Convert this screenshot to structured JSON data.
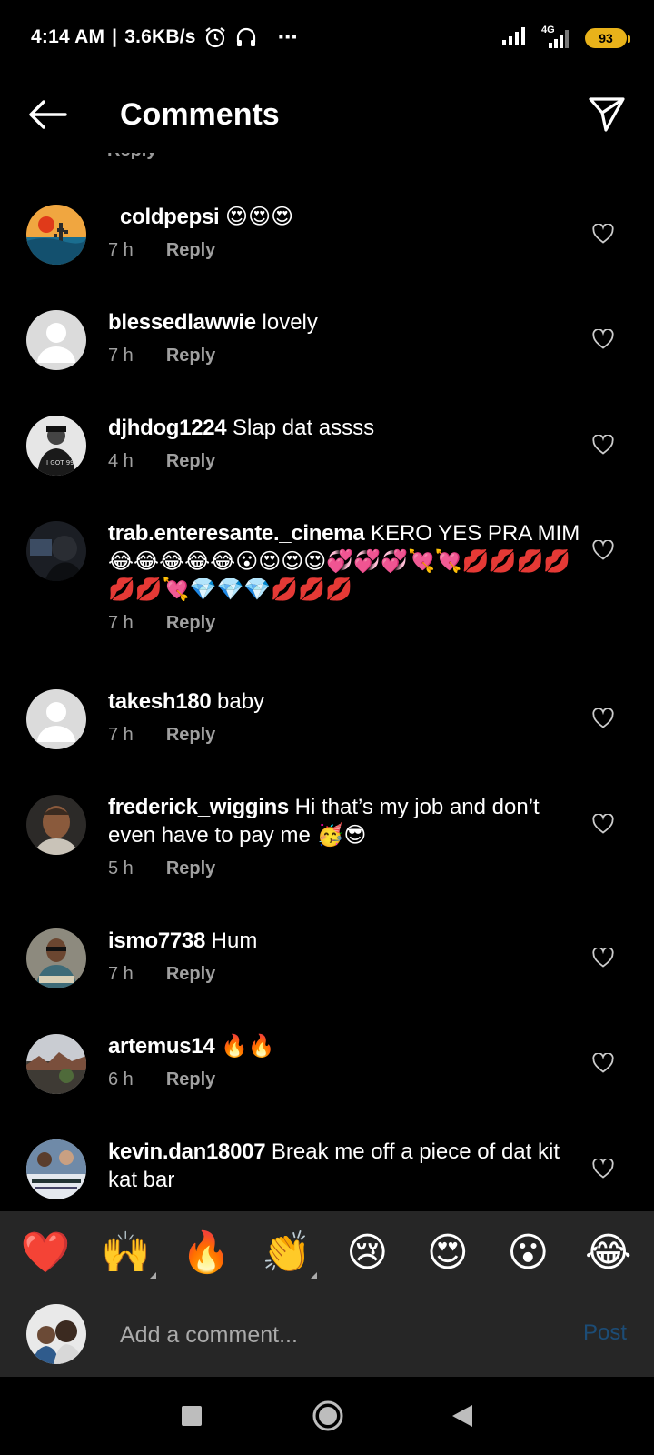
{
  "status_bar": {
    "time": "4:14 AM",
    "speed": "3.6KB/s",
    "network": "4G",
    "battery": "93",
    "more": "⋯"
  },
  "header": {
    "title": "Comments"
  },
  "peek_reply": "Reply",
  "comments": [
    {
      "username": "_coldpepsi",
      "text": " 😍😍😍",
      "time": "7 h",
      "reply": "Reply"
    },
    {
      "username": "blessedlawwie",
      "text": " lovely",
      "time": "7 h",
      "reply": "Reply"
    },
    {
      "username": "djhdog1224",
      "text": " Slap dat assss",
      "time": "4 h",
      "reply": "Reply"
    },
    {
      "username": "trab.enteresante._cinema",
      "text": " KERO YES PRA MIM 😂😂😂😂😂😮😍😍😍💞💞💞💘💘💋💋💋💋💋💋💘💎💎💎💋💋💋",
      "time": "7 h",
      "reply": "Reply"
    },
    {
      "username": "takesh180",
      "text": " baby",
      "time": "7 h",
      "reply": "Reply"
    },
    {
      "username": "frederick_wiggins",
      "text": " Hi that’s my job and don’t even have to pay me 🥳😎",
      "time": "5 h",
      "reply": "Reply"
    },
    {
      "username": "ismo7738",
      "text": " Hum",
      "time": "7 h",
      "reply": "Reply"
    },
    {
      "username": "artemus14",
      "text": " 🔥🔥",
      "time": "6 h",
      "reply": "Reply"
    },
    {
      "username": "kevin.dan18007",
      "text": " Break me off a piece of dat kit kat bar",
      "time": "",
      "reply": ""
    }
  ],
  "emoji_bar": [
    "❤️",
    "🙌",
    "🔥",
    "👏",
    "😢",
    "😍",
    "😮",
    "😂"
  ],
  "composer": {
    "placeholder": "Add a comment...",
    "post_label": "Post"
  },
  "colors": {
    "background": "#000000",
    "panel": "#262626",
    "secondary_text": "#a0a0a0",
    "post_disabled": "#1c4c76",
    "battery": "#e8b21a"
  }
}
